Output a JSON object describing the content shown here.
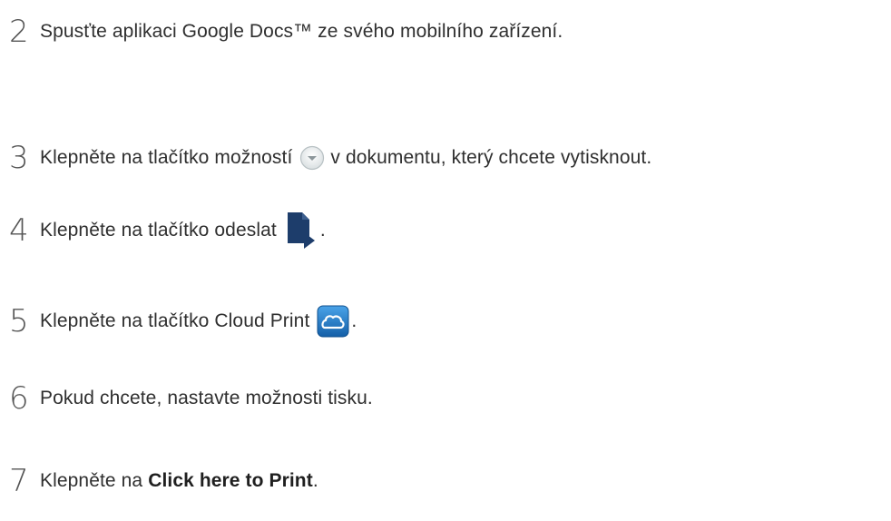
{
  "steps": [
    {
      "num": "2",
      "text": "Spusťte aplikaci Google Docs™ ze svého mobilního zařízení."
    },
    {
      "num": "3",
      "text_before": "Klepněte na tlačítko možností",
      "icon": "dropdown-circle-icon",
      "text_after": "v dokumentu, který chcete vytisknout."
    },
    {
      "num": "4",
      "text_before": "Klepněte na tlačítko odeslat",
      "icon": "send-document-icon",
      "text_after": "."
    },
    {
      "num": "5",
      "text_before": "Klepněte na tlačítko Cloud Print",
      "icon": "cloud-print-icon",
      "text_after": "."
    },
    {
      "num": "6",
      "text": "Pokud chcete, nastavte možnosti tisku."
    },
    {
      "num": "7",
      "text_before": "Klepněte na",
      "bold": "Click here to Print",
      "text_after": "."
    }
  ],
  "colors": {
    "text": "#2f2f2f",
    "number": "#555555",
    "send_icon": "#1d3d6b",
    "cloud_icon": "#1f77c9",
    "dropdown_icon": "#9aa3a6"
  }
}
